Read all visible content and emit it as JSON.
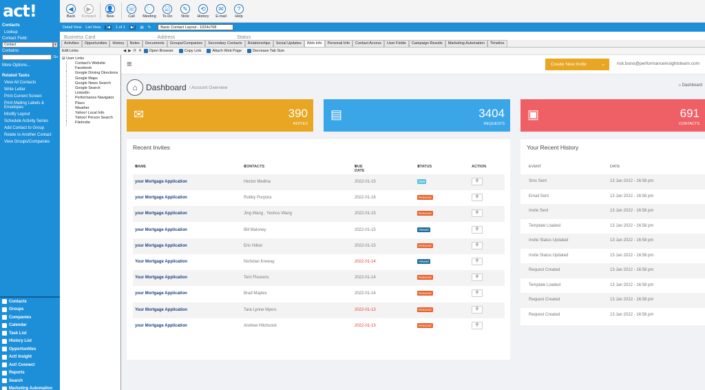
{
  "app": {
    "logo": "act!"
  },
  "sidebar": {
    "contacts_title": "Contacts",
    "lookup": "Lookup",
    "contact_field_label": "Contact Field:",
    "contact_field_value": "Contact",
    "contains_label": "Contains:",
    "go": "Go",
    "more_options": "More Options...",
    "related_tasks_title": "Related Tasks",
    "tasks": [
      "View All Contacts",
      "Write Letter",
      "Print Current Screen",
      "Print Mailing Labels & Envelopes",
      "Modify Layout",
      "Schedule Activity Series",
      "Add Contact to Group",
      "Relate to Another Contact",
      "View Groups/Companies"
    ],
    "nav": [
      "Contacts",
      "Groups",
      "Companies",
      "Calendar",
      "Task List",
      "History List",
      "Opportunities",
      "Act! Insight",
      "Act! Connect",
      "Reports",
      "Search",
      "Marketing Automation"
    ]
  },
  "toolbar": {
    "buttons": [
      "Back",
      "Forward",
      "New",
      "Call",
      "Meeting",
      "To-Do",
      "Note",
      "History",
      "E-mail",
      "Help"
    ]
  },
  "viewbar": {
    "detail_view": "Detail View",
    "list_view": "List View",
    "record": "1 of 1",
    "layout": "Basic Contact Layout - 1024x768"
  },
  "header_strip": [
    "Business Card",
    "Address",
    "Status"
  ],
  "tabs": [
    "Activities",
    "Opportunities",
    "History",
    "Notes",
    "Documents",
    "Groups/Companies",
    "Secondary Contacts",
    "Relationships",
    "Social Updates",
    "Web Info",
    "Personal Info",
    "Contact Access",
    "User Fields",
    "Campaign Results",
    "Marketing Automation",
    "Timeline"
  ],
  "active_tab": "Web Info",
  "links_panel": {
    "edit_links": "Edit Links",
    "root": "User Links",
    "items": [
      "Contact's Website",
      "Facebook",
      "Google Driving Directions",
      "Google Maps",
      "Google News Search",
      "Google Search",
      "LinkedIn",
      "Performance Navigator",
      "Plaxo",
      "Weather",
      "Yahoo! Local Info",
      "Yahoo! Person Search",
      "FileInvite"
    ]
  },
  "web_tools": [
    "Open Browser",
    "Copy Link",
    "Attach Web Page",
    "Decrease Tab Size"
  ],
  "webapp": {
    "create_button": "Create New Invite",
    "user_email": "rick.bono@performanceinsightsteam.com",
    "title": "Dashboard",
    "subtitle": "/ Account Overview",
    "breadcrumb": "Dashboard",
    "stats": {
      "invites": {
        "value": "390",
        "label": "Invites"
      },
      "requests": {
        "value": "3404",
        "label": "Requests"
      },
      "contacts": {
        "value": "691",
        "label": "Contacts"
      }
    },
    "recent_invites": {
      "title": "Recent Invites",
      "columns": {
        "name": "NAME",
        "contacts": "CONTACTS",
        "due": "DUE DATE",
        "status": "STATUS",
        "action": "ACTION"
      },
      "rows": [
        {
          "name": "your Mortgage Application",
          "contacts": "Hector Medina",
          "due": "2022-01-15",
          "late": false,
          "status": "Sent"
        },
        {
          "name": "your Mortgage Application",
          "contacts": "Robby Purpora",
          "due": "2022-01-16",
          "late": false,
          "status": "Returned"
        },
        {
          "name": "your Mortgage Application",
          "contacts": "Jing Wang , Yeshou Wang",
          "due": "2022-01-15",
          "late": false,
          "status": "Returned"
        },
        {
          "name": "your Mortgage Application",
          "contacts": "Bill Maloney",
          "due": "2022-01-15",
          "late": false,
          "status": "Viewed"
        },
        {
          "name": "your Mortgage Application",
          "contacts": "Eric Hilton",
          "due": "2022-01-15",
          "late": false,
          "status": "Returned"
        },
        {
          "name": "Your Mortgage Application",
          "contacts": "Nicholas Kreway",
          "due": "2022-01-14",
          "late": true,
          "status": "Viewed"
        },
        {
          "name": "Your Mortgage Application",
          "contacts": "Terri Flourens",
          "due": "2022-01-14",
          "late": false,
          "status": "Returned"
        },
        {
          "name": "your Mortgage Application",
          "contacts": "Brad Maples",
          "due": "2022-01-14",
          "late": false,
          "status": "Returned"
        },
        {
          "name": "Your Mortgage Application",
          "contacts": "Tara Lynne Myers",
          "due": "2022-01-13",
          "late": true,
          "status": "Returned"
        },
        {
          "name": "your Mortgage Application",
          "contacts": "Andrew Hitchcock",
          "due": "2022-01-13",
          "late": true,
          "status": "Returned"
        }
      ]
    },
    "recent_history": {
      "title": "Your Recent History",
      "columns": {
        "event": "EVENT",
        "date": "DATE"
      },
      "rows": [
        {
          "event": "Sms Sent",
          "date": "13 Jan 2022 - 16:58 pm"
        },
        {
          "event": "Email Sent",
          "date": "13 Jan 2022 - 16:58 pm"
        },
        {
          "event": "Invite Sent",
          "date": "13 Jan 2022 - 16:58 pm"
        },
        {
          "event": "Template Loaded",
          "date": "13 Jan 2022 - 16:58 pm"
        },
        {
          "event": "Invite Status Updated",
          "date": "13 Jan 2022 - 16:58 pm"
        },
        {
          "event": "Invite Status Updated",
          "date": "13 Jan 2022 - 16:58 pm"
        },
        {
          "event": "Request Created",
          "date": "13 Jan 2022 - 16:58 pm"
        },
        {
          "event": "Template Loaded",
          "date": "13 Jan 2022 - 16:58 pm"
        },
        {
          "event": "Request Created",
          "date": "13 Jan 2022 - 16:58 pm"
        },
        {
          "event": "Request Created",
          "date": "13 Jan 2022 - 16:58 pm"
        }
      ]
    },
    "status_colors": {
      "Sent": "#5bc0de",
      "Returned": "#e8622c",
      "Viewed": "#1d6fa0"
    }
  }
}
